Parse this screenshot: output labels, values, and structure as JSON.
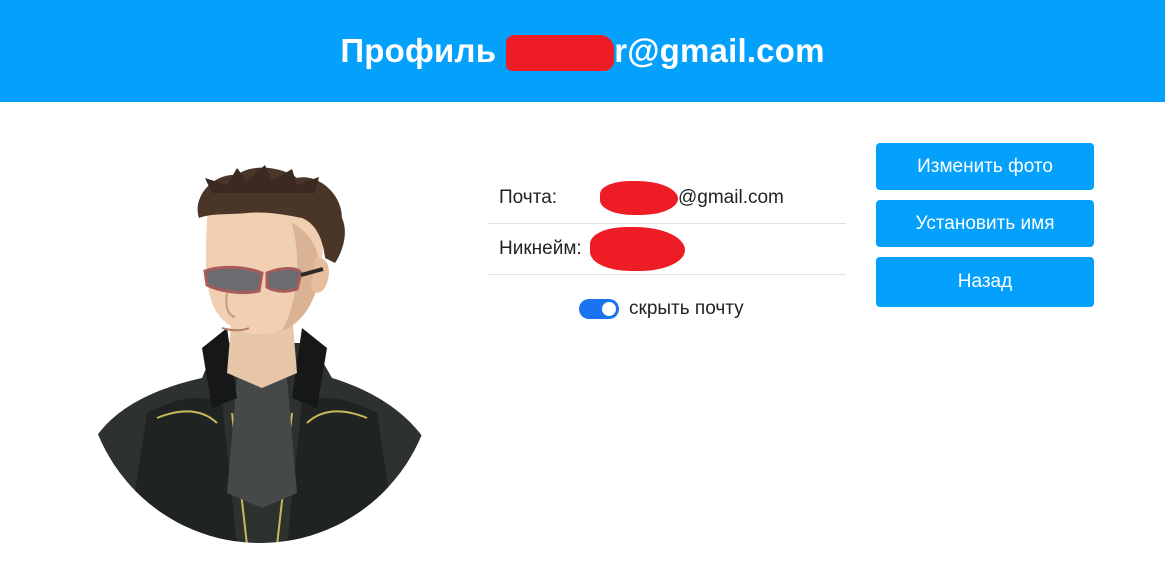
{
  "header": {
    "title_prefix": "Профиль",
    "title_suffix": "r@gmail.com"
  },
  "profile": {
    "email_label": "Почта:",
    "email_value_visible": "@gmail.com",
    "nickname_label": "Никнейм:"
  },
  "settings": {
    "hide_email_label": "скрыть почту",
    "hide_email_enabled": true
  },
  "actions": {
    "change_photo": "Изменить фото",
    "set_name": "Установить имя",
    "back": "Назад"
  },
  "colors": {
    "accent": "#03a1fc",
    "toggle": "#1a73f0",
    "redaction": "#ee1c24"
  }
}
